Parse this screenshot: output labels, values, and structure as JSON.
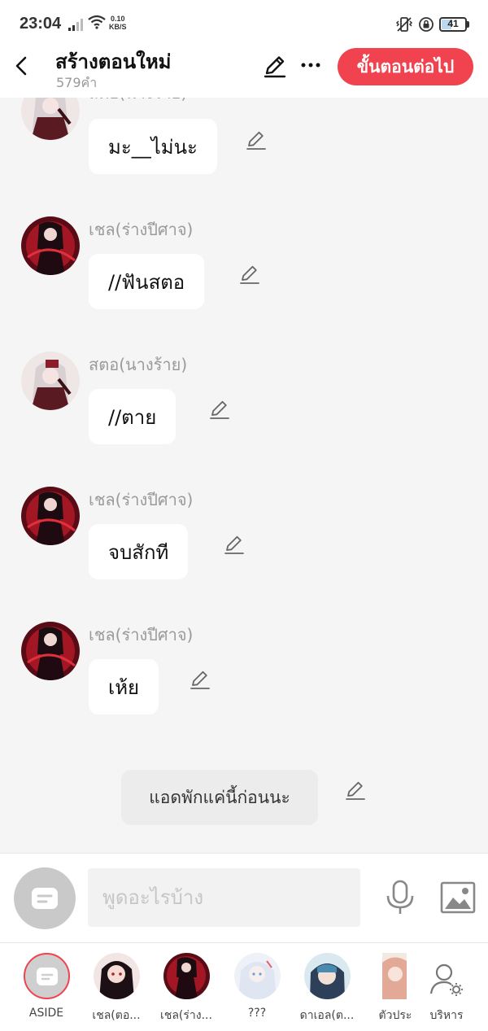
{
  "status_bar": {
    "time": "23:04",
    "speed_value": "0.10",
    "speed_unit": "KB/S",
    "battery": "41"
  },
  "header": {
    "title": "สร้างตอนใหม่",
    "word_count": "579คำ",
    "next_button": "ขั้นตอนต่อไป"
  },
  "messages": [
    {
      "speaker": "สตอ(นางร้าย)",
      "text": "มะ__ไม่นะ"
    },
    {
      "speaker": "เชล(ร่างปีศาจ)",
      "text": "//ฟันสตอ"
    },
    {
      "speaker": "สตอ(นางร้าย)",
      "text": "//ตาย"
    },
    {
      "speaker": "เชล(ร่างปีศาจ)",
      "text": "จบสักที"
    },
    {
      "speaker": "เชล(ร่างปีศาจ)",
      "text": "เห้ย"
    }
  ],
  "narration": "แอดพักแค่นี้ก่อนนะ",
  "composer": {
    "placeholder": "พูดอะไรบ้าง"
  },
  "characters": [
    {
      "label": "ASIDE"
    },
    {
      "label": "เชล(ตอ..."
    },
    {
      "label": "เชล(ร่าง..."
    },
    {
      "label": "???"
    },
    {
      "label": "ดาเอล(ต..."
    },
    {
      "label": "ตัวประ"
    },
    {
      "label": "บริหาร"
    }
  ],
  "colors": {
    "accent": "#f0434f",
    "background": "#f5f5f5",
    "bubble": "#ffffff",
    "muted_text": "#9a9a9a"
  }
}
